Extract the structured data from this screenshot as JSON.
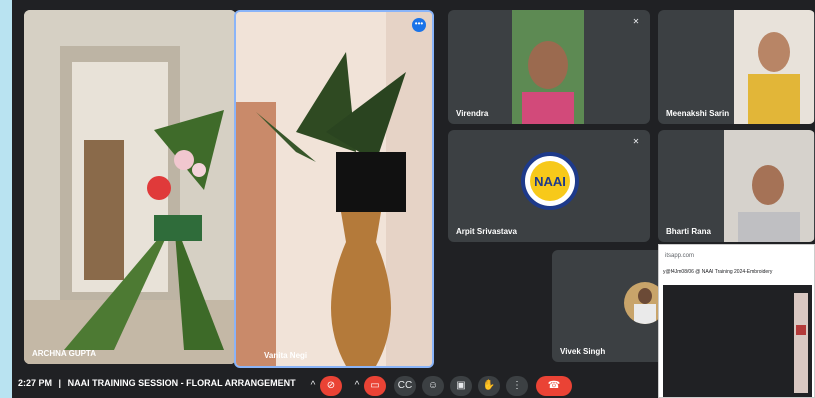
{
  "meeting": {
    "time": "2:27 PM",
    "separator": "|",
    "title": "NAAI TRAINING SESSION - FLORAL ARRANGEMENT"
  },
  "participants": [
    {
      "name": "ARCHNA GUPTA"
    },
    {
      "name": "Vanita Negi"
    },
    {
      "name": "Virendra"
    },
    {
      "name": "Meenakshi Sarin"
    },
    {
      "name": "Arpit Srivastava"
    },
    {
      "name": "Bharti Rana"
    },
    {
      "name": "Vivek Singh"
    }
  ],
  "logo": {
    "text": "NAAI",
    "ring_text": "NATIONAL ABILYMPIC ASSOCIATION OF INDIA"
  },
  "popup": {
    "url": "itsapp.com",
    "heading": "y@f4Jm08/06 @ NAAI Training 2024-Embroidery"
  },
  "colors": {
    "accent": "#1a73e8",
    "danger": "#ea4335",
    "bg": "#202124",
    "tile": "#3c4043"
  }
}
